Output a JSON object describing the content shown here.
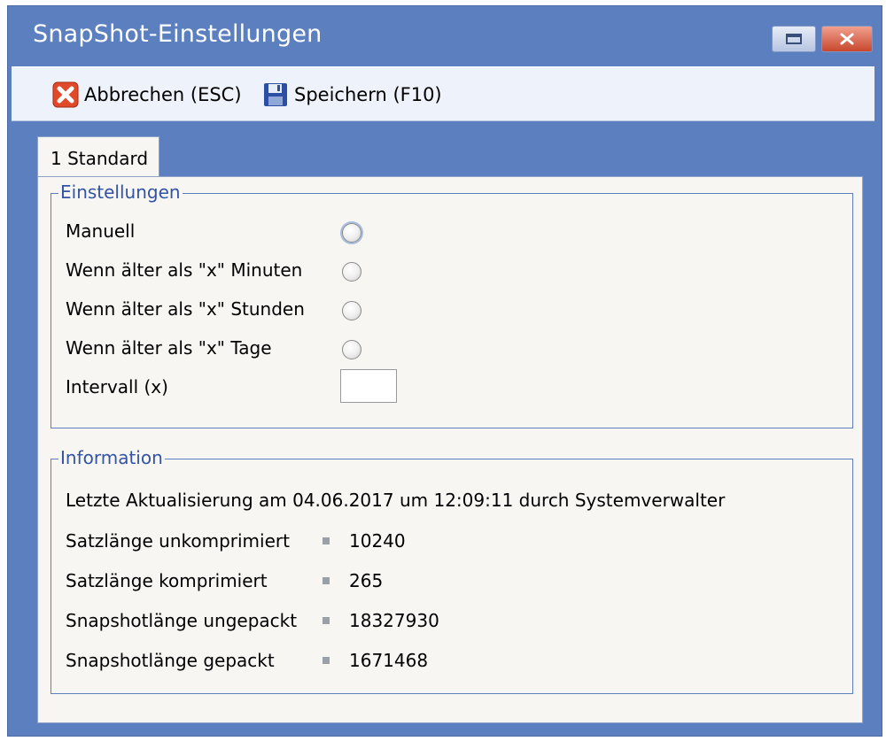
{
  "window": {
    "title": "SnapShot-Einstellungen",
    "restore_icon": "restore-icon",
    "close_icon": "close-icon"
  },
  "toolbar": {
    "cancel_label": "Abbrechen (ESC)",
    "cancel_icon": "cancel-icon",
    "save_label": "Speichern (F10)",
    "save_icon": "floppy-disk-icon"
  },
  "tabs": [
    {
      "label": "1 Standard",
      "active": true
    }
  ],
  "settings": {
    "legend": "Einstellungen",
    "options": [
      {
        "label": "Manuell",
        "selected": false
      },
      {
        "label": "Wenn älter als \"x\" Minuten",
        "selected": false
      },
      {
        "label": "Wenn älter als \"x\" Stunden",
        "selected": false
      },
      {
        "label": "Wenn älter als \"x\" Tage",
        "selected": false
      }
    ],
    "interval_label": "Intervall (x)",
    "interval_value": ""
  },
  "information": {
    "legend": "Information",
    "last_update": "Letzte Aktualisierung am 04.06.2017 um 12:09:11 durch Systemverwalter",
    "rows": [
      {
        "label": "Satzlänge unkomprimiert",
        "value": "10240"
      },
      {
        "label": "Satzlänge komprimiert",
        "value": "265"
      },
      {
        "label": "Snapshotlänge ungepackt",
        "value": "18327930"
      },
      {
        "label": "Snapshotlänge gepackt",
        "value": "1671468"
      }
    ]
  },
  "colors": {
    "titlebar": "#5b7fbf",
    "legend_text": "#3353a3",
    "panel": "#f7f6f3"
  }
}
